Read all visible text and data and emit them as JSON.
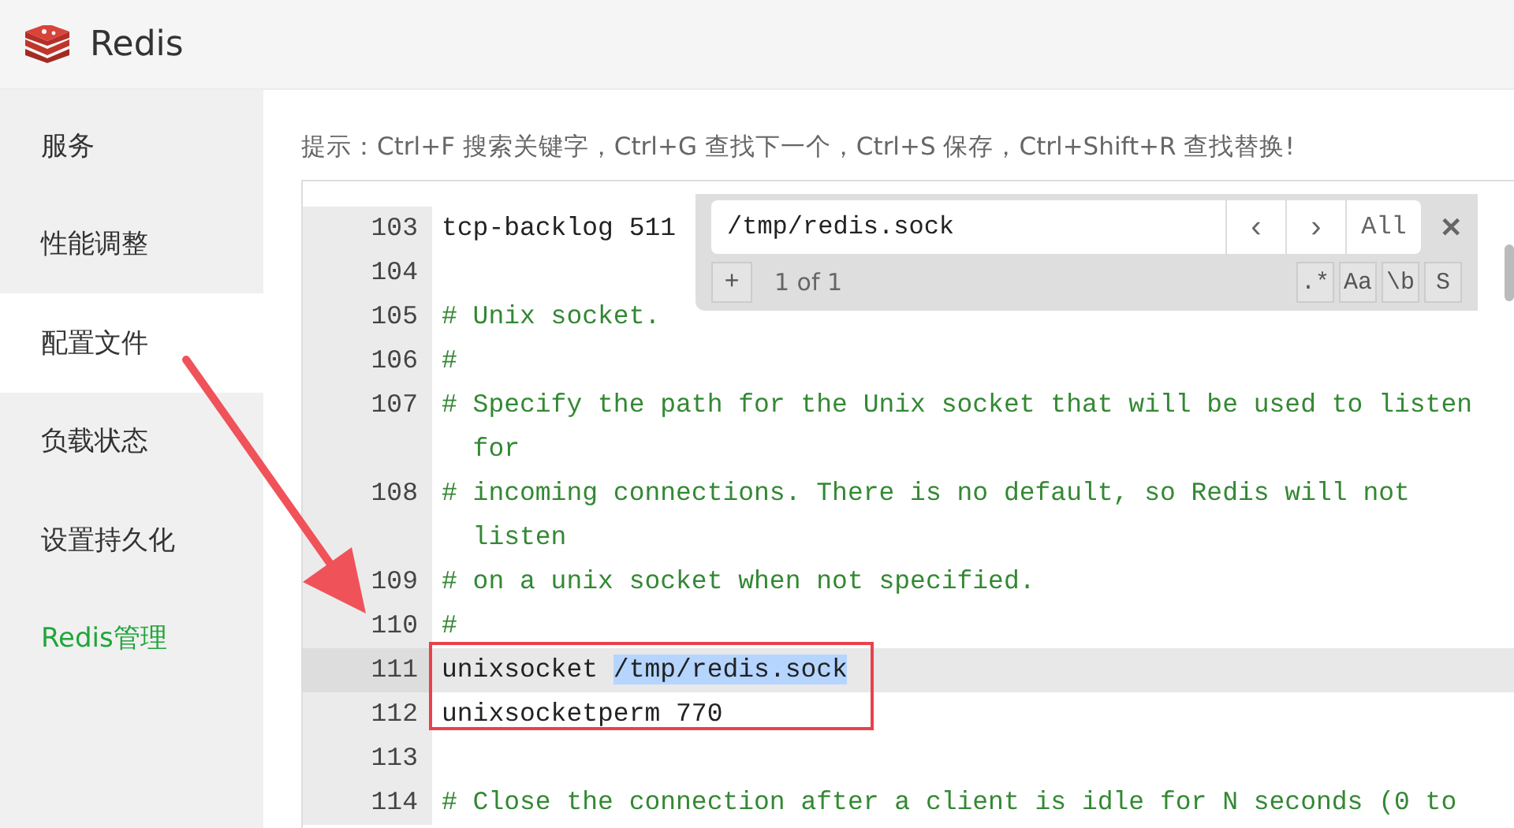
{
  "app": {
    "title": "Redis"
  },
  "sidebar": {
    "items": [
      {
        "label": "服务",
        "selected": false,
        "kind": "normal"
      },
      {
        "label": "性能调整",
        "selected": false,
        "kind": "normal"
      },
      {
        "label": "配置文件",
        "selected": true,
        "kind": "normal"
      },
      {
        "label": "负载状态",
        "selected": false,
        "kind": "normal"
      },
      {
        "label": "设置持久化",
        "selected": false,
        "kind": "normal"
      },
      {
        "label": "Redis管理",
        "selected": false,
        "kind": "accent"
      }
    ]
  },
  "hint": "提示：Ctrl+F 搜索关键字，Ctrl+G 查找下一个，Ctrl+S 保存，Ctrl+Shift+R 查找替换!",
  "search": {
    "value": "/tmp/redis.sock",
    "prev": "‹",
    "next": "›",
    "all": "All",
    "close": "✕",
    "add": "+",
    "count": "1 of 1",
    "toggles": [
      ".*",
      "Aa",
      "\\b",
      "S"
    ]
  },
  "editor": {
    "lines": [
      {
        "number": "103",
        "kind": "code",
        "text": "tcp-backlog 511",
        "active": false
      },
      {
        "number": "104",
        "kind": "blank",
        "active": false
      },
      {
        "number": "105",
        "kind": "comment",
        "text": "# Unix socket.",
        "active": false
      },
      {
        "number": "106",
        "kind": "comment",
        "text": "#",
        "active": false
      },
      {
        "number": "107",
        "kind": "comment",
        "text": "# Specify the path for the Unix socket that will be used to listen for",
        "active": false
      },
      {
        "number": "108",
        "kind": "comment",
        "text": "# incoming connections. There is no default, so Redis will not listen",
        "active": false
      },
      {
        "number": "109",
        "kind": "comment",
        "text": "# on a unix socket when not specified.",
        "active": false
      },
      {
        "number": "110",
        "kind": "comment",
        "text": "#",
        "active": false
      },
      {
        "number": "111",
        "kind": "code",
        "text": "unixsocket ",
        "match": "/tmp/redis.sock",
        "active": true
      },
      {
        "number": "112",
        "kind": "code",
        "text": "unixsocketperm 770",
        "active": false
      },
      {
        "number": "113",
        "kind": "blank",
        "active": false
      },
      {
        "number": "114",
        "kind": "comment",
        "text": "# Close the connection after a client is idle for N seconds (0 to",
        "active": false
      }
    ]
  }
}
